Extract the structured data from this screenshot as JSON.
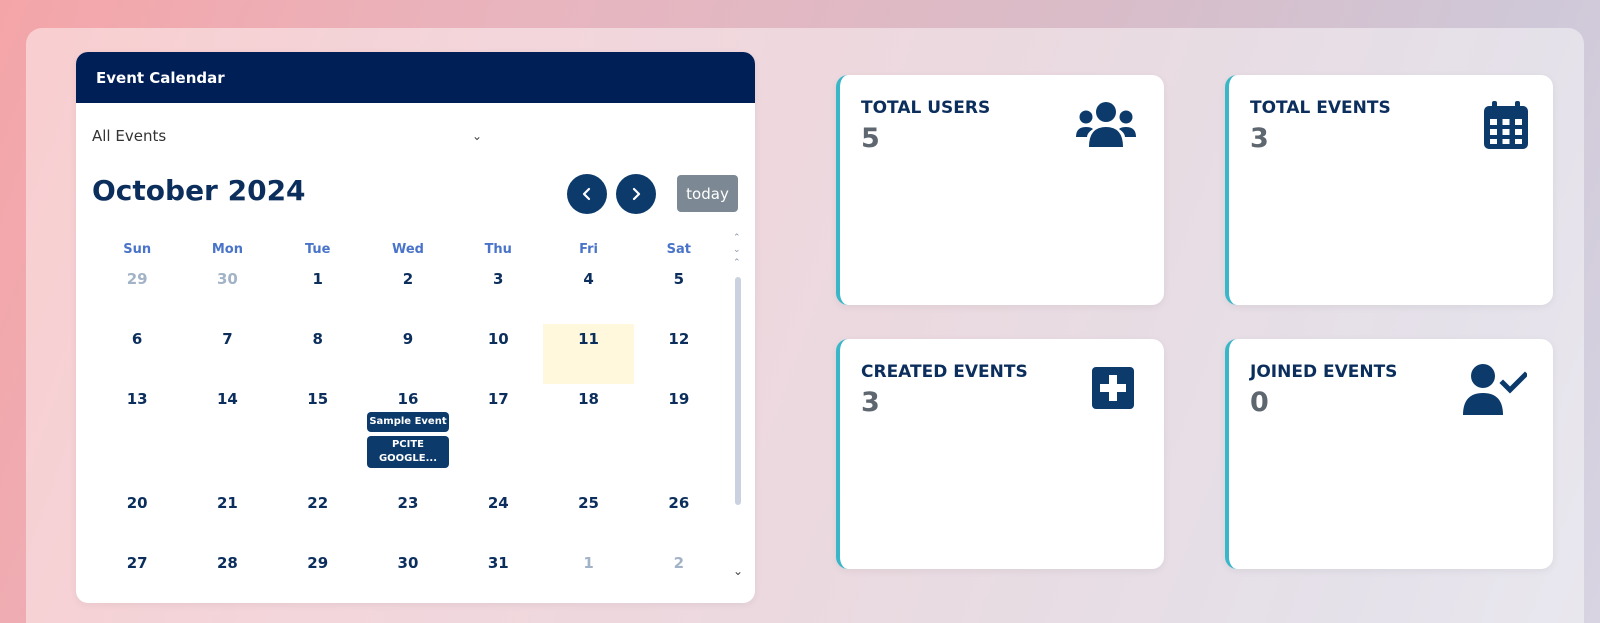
{
  "calendar": {
    "header_title": "Event Calendar",
    "filter_value": "All Events",
    "month_title": "October 2024",
    "today_label": "today",
    "days_of_week": [
      "Sun",
      "Mon",
      "Tue",
      "Wed",
      "Thu",
      "Fri",
      "Sat"
    ],
    "weeks": [
      [
        {
          "d": "29",
          "m": true
        },
        {
          "d": "30",
          "m": true
        },
        {
          "d": "1"
        },
        {
          "d": "2"
        },
        {
          "d": "3"
        },
        {
          "d": "4"
        },
        {
          "d": "5"
        }
      ],
      [
        {
          "d": "6"
        },
        {
          "d": "7"
        },
        {
          "d": "8"
        },
        {
          "d": "9"
        },
        {
          "d": "10"
        },
        {
          "d": "11",
          "today": true
        },
        {
          "d": "12"
        }
      ],
      [
        {
          "d": "13"
        },
        {
          "d": "14"
        },
        {
          "d": "15"
        },
        {
          "d": "16",
          "events": [
            "Sample Event",
            "PCITE GOOGLE..."
          ]
        },
        {
          "d": "17"
        },
        {
          "d": "18"
        },
        {
          "d": "19"
        }
      ],
      [
        {
          "d": "20"
        },
        {
          "d": "21"
        },
        {
          "d": "22"
        },
        {
          "d": "23"
        },
        {
          "d": "24"
        },
        {
          "d": "25"
        },
        {
          "d": "26"
        }
      ],
      [
        {
          "d": "27"
        },
        {
          "d": "28"
        },
        {
          "d": "29"
        },
        {
          "d": "30"
        },
        {
          "d": "31"
        },
        {
          "d": "1",
          "m": true
        },
        {
          "d": "2",
          "m": true
        }
      ]
    ]
  },
  "stats": {
    "total_users": {
      "label": "TOTAL USERS",
      "value": "5",
      "icon": "users-icon"
    },
    "total_events": {
      "label": "TOTAL EVENTS",
      "value": "3",
      "icon": "calendar-icon"
    },
    "created_events": {
      "label": "CREATED EVENTS",
      "value": "3",
      "icon": "plus-square-icon"
    },
    "joined_events": {
      "label": "JOINED EVENTS",
      "value": "0",
      "icon": "user-check-icon"
    }
  },
  "colors": {
    "header_bg": "#001f57",
    "accent": "#0b3a6b",
    "card_border": "#3ab6c9",
    "today_highlight": "#fff8dc"
  }
}
